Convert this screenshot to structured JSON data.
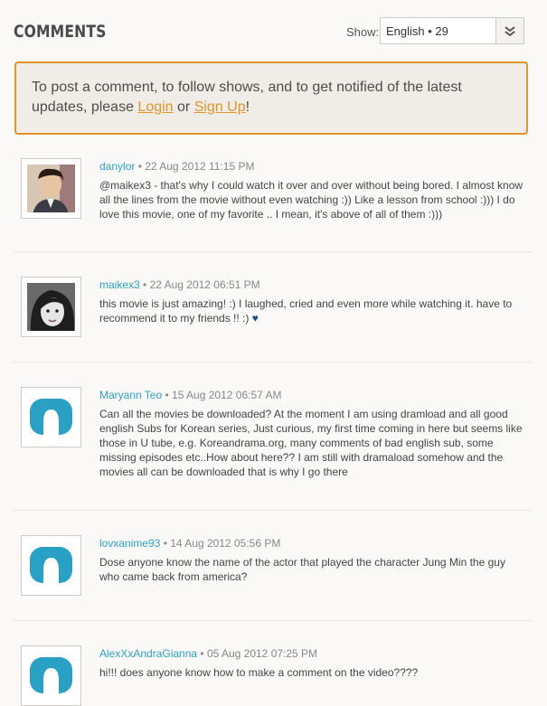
{
  "header": {
    "title": "COMMENTS",
    "show_label": "Show:",
    "show_value": "English • 29"
  },
  "notice": {
    "text_before": "To post a comment, to follow shows, and to get notified of the latest updates, please ",
    "login": "Login",
    "or": " or ",
    "signup": "Sign Up",
    "text_after": "!"
  },
  "comments": [
    {
      "user": "danylor",
      "date": "• 22 Aug 2012 11:15 PM",
      "text": "@maikex3 - that's why I could watch it over and over without being bored. I almost know all the lines from the movie without even watching :)) Like a lesson from school :))) I do love this movie, one of my favorite .. I mean, it's above of all of them :)))",
      "avatar": "photo-man"
    },
    {
      "user": "maikex3",
      "date": "• 22 Aug 2012 06:51 PM",
      "text": "this movie is just amazing! :) I laughed, cried and even more while watching it. have to recommend it to my friends !! :)",
      "heart": "♥",
      "avatar": "photo-woman"
    },
    {
      "user": "Maryann Teo",
      "date": "• 15 Aug 2012 06:57 AM",
      "text": "Can all the movies be downloaded? At the moment I am using dramload and all good english Subs for Korean series, Just curious, my first time coming in here but seems like those in U tube, e.g. Koreandrama.org, many comments of bad english sub, some missing episodes etc..How about here?? I am still with dramaload somehow and the movies all can be downloaded that is why I go there",
      "avatar": "default"
    },
    {
      "user": "lovxanime93",
      "date": "• 14 Aug 2012 05:56 PM",
      "text": "Dose anyone know the name of the actor that played the character Jung Min the guy who came back from america?",
      "avatar": "default"
    },
    {
      "user": "AlexXxAndraGianna",
      "date": "• 05 Aug 2012 07:25 PM",
      "text": "hi!!! does anyone know how to make a comment on the video????",
      "avatar": "default"
    }
  ]
}
